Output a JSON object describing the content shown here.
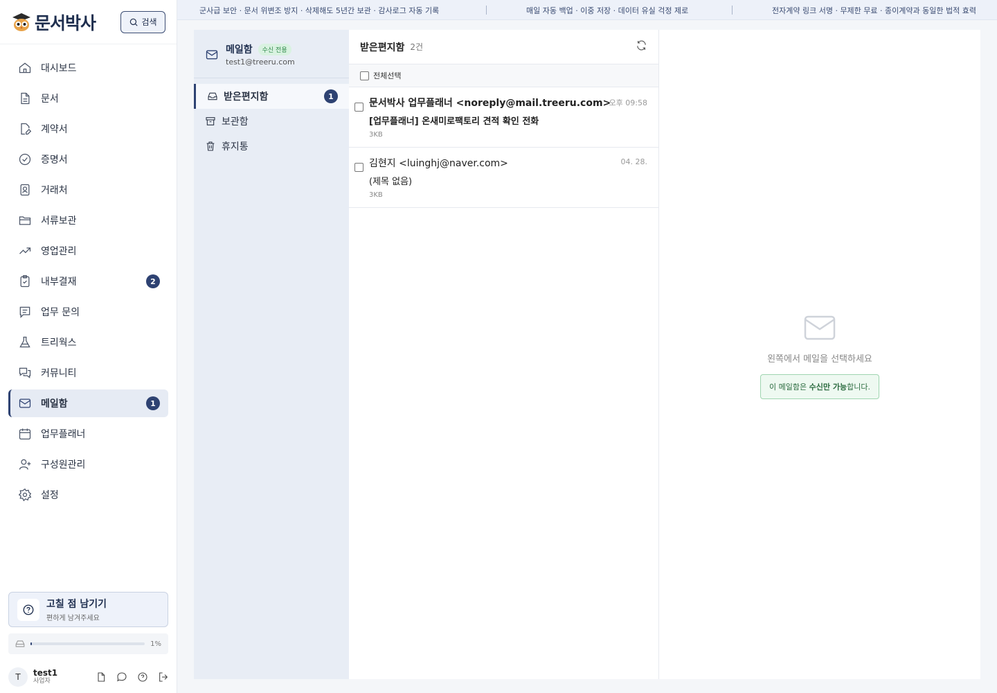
{
  "app": {
    "name": "문서박사"
  },
  "search": {
    "label": "검색"
  },
  "marquee": {
    "messages": [
      "군사급 보안 · 문서 위변조 방지 · 삭제해도 5년간 보관 · 감사로그 자동 기록",
      "매일 자동 백업 · 이중 저장 · 데이터 유실 걱정 제로",
      "전자계약 링크 서명 · 무제한 무료 · 종이계약과 동일한 법적 효력"
    ]
  },
  "sidebar": {
    "items": [
      {
        "label": "대시보드",
        "icon": "home-icon"
      },
      {
        "label": "문서",
        "icon": "document-icon"
      },
      {
        "label": "계약서",
        "icon": "contract-edit-icon"
      },
      {
        "label": "증명서",
        "icon": "certificate-check-icon"
      },
      {
        "label": "거래처",
        "icon": "contact-card-icon"
      },
      {
        "label": "서류보관",
        "icon": "folder-icon"
      },
      {
        "label": "영업관리",
        "icon": "trend-up-icon"
      },
      {
        "label": "내부결재",
        "icon": "clipboard-check-icon",
        "badge": "2"
      },
      {
        "label": "업무 문의",
        "icon": "message-lines-icon"
      },
      {
        "label": "트리웍스",
        "icon": "flask-icon"
      },
      {
        "label": "커뮤니티",
        "icon": "chat-bubbles-icon"
      },
      {
        "label": "메일함",
        "icon": "mail-icon",
        "badge": "1",
        "active": true
      },
      {
        "label": "업무플래너",
        "icon": "calendar-icon"
      },
      {
        "label": "구성원관리",
        "icon": "user-plus-icon"
      },
      {
        "label": "설정",
        "icon": "gear-icon"
      }
    ]
  },
  "feedback": {
    "title": "고칠 점 남기기",
    "subtitle": "편하게 남겨주세요"
  },
  "storage": {
    "percent_label": "1%",
    "fraction": 0.01
  },
  "user": {
    "initial": "T",
    "name": "test1",
    "role": "사업자"
  },
  "mailbox": {
    "title": "메일함",
    "tag": "수신 전용",
    "address": "test1@treeru.com",
    "folders": [
      {
        "label": "받은편지함",
        "icon": "inbox-icon",
        "badge": "1",
        "active": true
      },
      {
        "label": "보관함",
        "icon": "archive-icon"
      },
      {
        "label": "휴지통",
        "icon": "trash-icon"
      }
    ]
  },
  "list": {
    "title": "받은편지함",
    "count": "2건",
    "select_all": "전체선택",
    "mails": [
      {
        "from": "문서박사 업무플래너 <noreply@mail.treeru.com>",
        "subject": "[업무플래너] 온새미로팩토리 견적 확인 전화",
        "size": "3KB",
        "time": "오후 09:58",
        "unread": true
      },
      {
        "from": "김현지 <luinghj@naver.com>",
        "subject": "(제목 없음)",
        "size": "3KB",
        "time": "04. 28.",
        "unread": false
      }
    ]
  },
  "preview": {
    "empty_text": "왼쪽에서 메일을 선택하세요",
    "notice_prefix": "이 메일함은 ",
    "notice_bold": "수신만 가능",
    "notice_suffix": "합니다."
  },
  "colors": {
    "accent": "#2e4272",
    "recv_tag_bg": "#d9f2e1",
    "notice_border": "#9fd5b0"
  }
}
